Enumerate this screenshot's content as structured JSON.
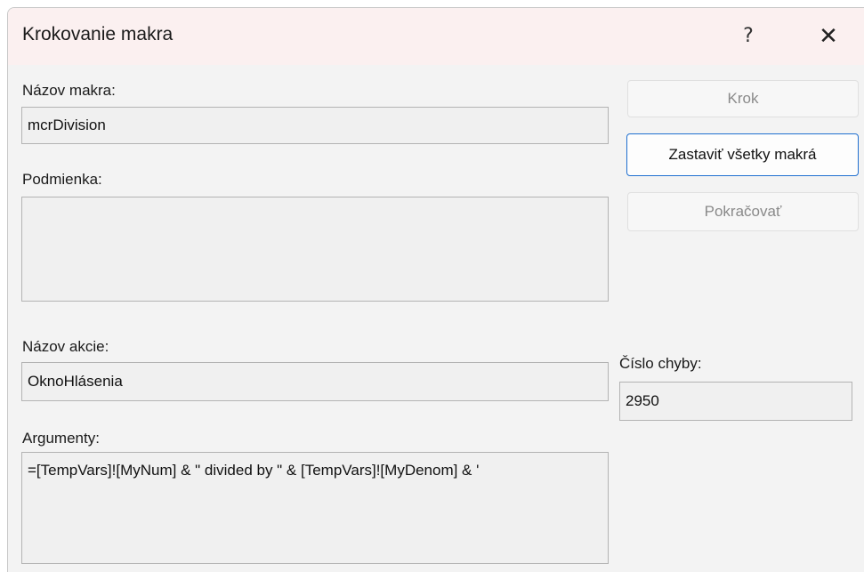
{
  "window": {
    "title": "Krokovanie makra",
    "help_label": "?",
    "close_label": "✕"
  },
  "fields": {
    "macro_name": {
      "label": "Názov makra:",
      "value": "mcrDivision"
    },
    "condition": {
      "label": "Podmienka:",
      "value": ""
    },
    "action_name": {
      "label": "Názov akcie:",
      "value": "OknoHlásenia"
    },
    "arguments": {
      "label": "Argumenty:",
      "value": "=[TempVars]![MyNum] & \" divided by \" & [TempVars]![MyDenom] & '"
    },
    "error_number": {
      "label": "Číslo chyby:",
      "value": "2950"
    }
  },
  "buttons": {
    "step": {
      "label": "Krok",
      "enabled": false
    },
    "stop_all": {
      "label": "Zastaviť všetky makrá",
      "enabled": true
    },
    "continue": {
      "label": "Pokračovať",
      "enabled": false
    }
  },
  "colors": {
    "title_bar": "#fbf0f0",
    "dialog_bg": "#f3f3f3",
    "field_bg": "#f0f0f0",
    "focus_border": "#1f6fd0"
  }
}
